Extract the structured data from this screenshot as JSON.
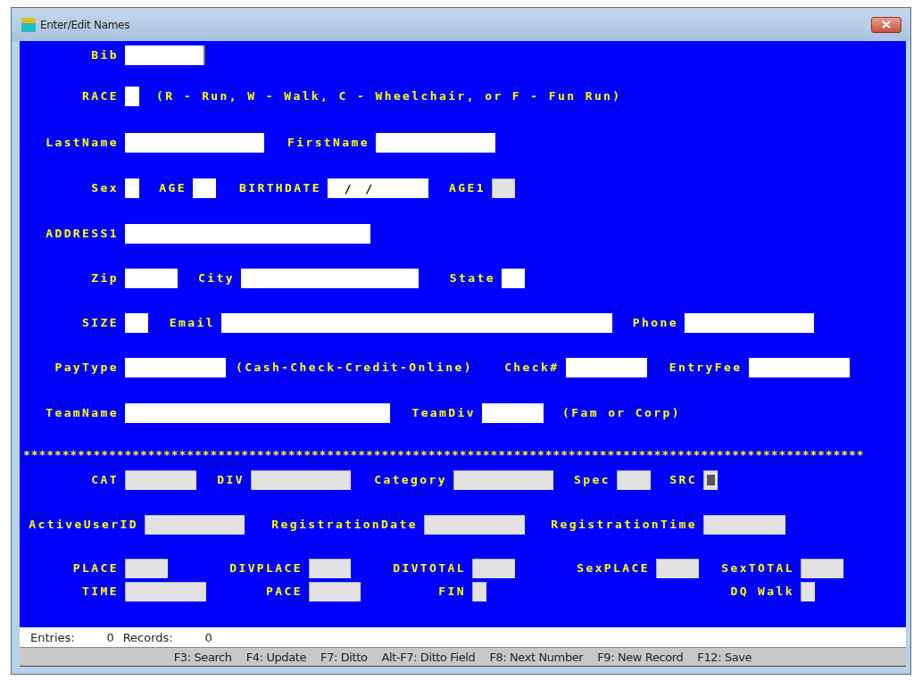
{
  "window": {
    "title": "Enter/Edit Names"
  },
  "form": {
    "rows": [
      {
        "kind": "fields",
        "items": [
          {
            "kind": "field",
            "label": "Bib",
            "cursor": true,
            "disabled": false
          }
        ]
      },
      {
        "kind": "fields",
        "items": [
          {
            "kind": "field",
            "label": "RACE",
            "disabled": false
          },
          {
            "kind": "note",
            "text": "(R - Run, W - Walk, C - Wheelchair, or F - Fun Run)"
          }
        ]
      },
      {
        "kind": "fields",
        "items": [
          {
            "kind": "field",
            "label": "LastName",
            "disabled": false
          },
          {
            "kind": "field",
            "label": "FirstName",
            "disabled": false
          }
        ]
      },
      {
        "kind": "fields",
        "items": [
          {
            "kind": "field",
            "label": "Sex",
            "disabled": false
          },
          {
            "kind": "field",
            "label": "AGE",
            "disabled": false
          },
          {
            "kind": "field",
            "label": "BIRTHDATE",
            "value": "  /  /",
            "disabled": false
          },
          {
            "kind": "field",
            "label": "AGE1",
            "disabled": true
          }
        ]
      },
      {
        "kind": "fields",
        "items": [
          {
            "kind": "field",
            "label": "ADDRESS1",
            "disabled": false
          }
        ]
      },
      {
        "kind": "fields",
        "items": [
          {
            "kind": "field",
            "label": "Zip",
            "disabled": false
          },
          {
            "kind": "field",
            "label": "City",
            "disabled": false
          },
          {
            "kind": "field",
            "label": "State",
            "disabled": false
          }
        ]
      },
      {
        "kind": "fields",
        "items": [
          {
            "kind": "field",
            "label": "SIZE",
            "disabled": false
          },
          {
            "kind": "field",
            "label": "Email",
            "disabled": false
          },
          {
            "kind": "field",
            "label": "Phone",
            "disabled": false
          }
        ]
      },
      {
        "kind": "fields",
        "items": [
          {
            "kind": "field",
            "label": "PayType",
            "disabled": false
          },
          {
            "kind": "note",
            "text": "(Cash-Check-Credit-Online)"
          },
          {
            "kind": "field",
            "label": "Check#",
            "disabled": false
          },
          {
            "kind": "field",
            "label": "EntryFee",
            "disabled": false
          }
        ]
      },
      {
        "kind": "fields",
        "items": [
          {
            "kind": "field",
            "label": "TeamName",
            "disabled": false
          },
          {
            "kind": "field",
            "label": "TeamDiv",
            "disabled": false
          },
          {
            "kind": "note",
            "text": "(Fam or Corp)"
          }
        ]
      },
      {
        "kind": "separator",
        "text": "************************************************************************************************************"
      },
      {
        "kind": "fields",
        "items": [
          {
            "kind": "field",
            "label": "CAT",
            "disabled": true
          },
          {
            "kind": "field",
            "label": "DIV",
            "disabled": true
          },
          {
            "kind": "field",
            "label": "Category",
            "disabled": true
          },
          {
            "kind": "field",
            "label": "Spec",
            "disabled": true
          },
          {
            "kind": "field",
            "label": "SRC",
            "disabled": true,
            "marked": true
          }
        ]
      },
      {
        "kind": "fields",
        "items": [
          {
            "kind": "field",
            "label": "ActiveUserID",
            "disabled": true
          },
          {
            "kind": "field",
            "label": "RegistrationDate",
            "disabled": true
          },
          {
            "kind": "field",
            "label": "RegistrationTime",
            "disabled": true
          }
        ]
      },
      {
        "kind": "fields",
        "items": [
          {
            "kind": "field",
            "label": "PLACE",
            "disabled": true
          },
          {
            "kind": "field",
            "label": "DIVPLACE",
            "disabled": true
          },
          {
            "kind": "field",
            "label": "DIVTOTAL",
            "disabled": true
          },
          {
            "kind": "field",
            "label": "SexPLACE",
            "disabled": true
          },
          {
            "kind": "field",
            "label": "SexTOTAL",
            "disabled": true
          }
        ]
      },
      {
        "kind": "fields",
        "items": [
          {
            "kind": "field",
            "label": "TIME",
            "disabled": true
          },
          {
            "kind": "field",
            "label": "PACE",
            "disabled": true
          },
          {
            "kind": "field",
            "label": "FIN",
            "disabled": true
          },
          {
            "kind": "field",
            "label": "DQ Walk",
            "disabled": true
          }
        ]
      }
    ]
  },
  "status_bar": {
    "counts": [
      {
        "label": "Entries:",
        "value": "0"
      },
      {
        "label": "Records:",
        "value": "0"
      }
    ]
  },
  "function_keys": [
    "F3: Search",
    "F4: Update",
    "F7: Ditto",
    "Alt-F7: Ditto Field",
    "F8: Next Number",
    "F9: New Record",
    "F12: Save"
  ]
}
